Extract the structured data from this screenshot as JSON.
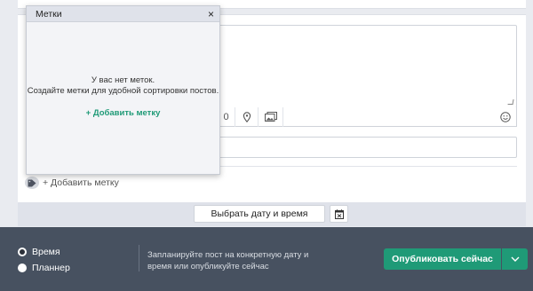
{
  "composer": {
    "toolbar": {
      "char_counter": "0"
    }
  },
  "tags": {
    "add_label": "+ Добавить метку"
  },
  "schedule": {
    "date_button_label": "Выбрать дату и время"
  },
  "footer": {
    "options": [
      {
        "label": "Время",
        "selected": true
      },
      {
        "label": "Планнер",
        "selected": false
      }
    ],
    "hint": "Запланируйте пост на конкретную дату и время или опубликуйте сейчас",
    "publish_label": "Опубликовать сейчас"
  },
  "tag_popover": {
    "title": "Метки",
    "close_glyph": "×",
    "empty_line1": "У вас нет меток.",
    "empty_line2": "Создайте метки для удобной сортировки постов.",
    "add_link": "+ Добавить метку"
  },
  "colors": {
    "accent": "#1f9a77",
    "footer_bg": "#475160",
    "page_bg": "#e9ebf0",
    "popover_header": "#dfe2ea"
  }
}
